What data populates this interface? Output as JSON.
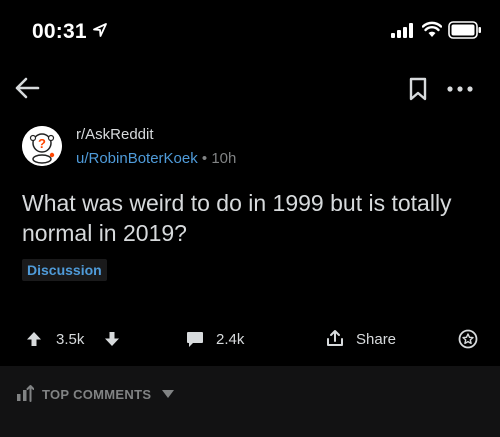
{
  "status_bar": {
    "time": "00:31",
    "icons": [
      "location-arrow-icon",
      "signal-icon",
      "wifi-icon",
      "battery-icon"
    ]
  },
  "nav": {
    "icons": [
      "back-arrow-icon",
      "bookmark-icon",
      "more-icon"
    ]
  },
  "post": {
    "subreddit": "r/AskReddit",
    "author": "u/RobinBoterKoek",
    "separator": " • ",
    "age": "10h",
    "title": "What was weird to do in 1999 but is totally normal in 2019?",
    "flair": "Discussion"
  },
  "actions": {
    "score": "3.5k",
    "comments": "2.4k",
    "share": "Share"
  },
  "comments": {
    "sort_label": "TOP COMMENTS"
  },
  "colors": {
    "background": "#000000",
    "text": "#d7dadc",
    "meta": "#818384",
    "link": "#4f9bd9",
    "divider": "#121213"
  }
}
